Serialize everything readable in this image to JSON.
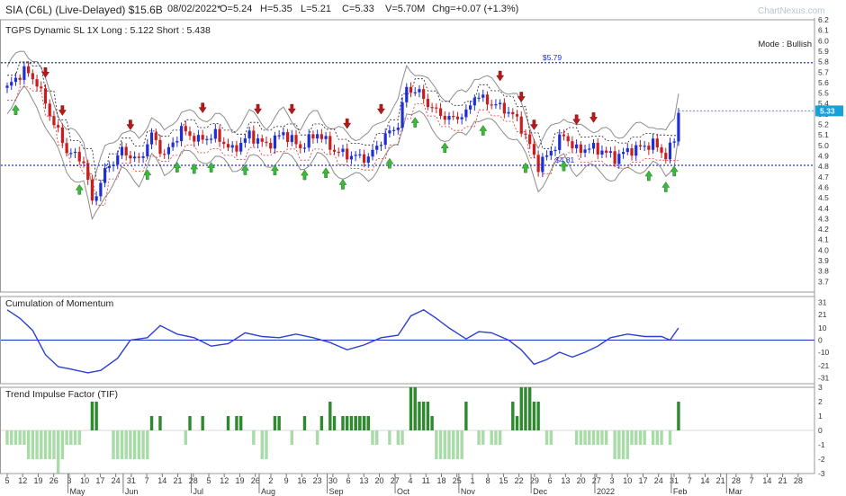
{
  "header": {
    "title": "SIA (C6L) (Live-Delayed) $15.6B",
    "date": "08/02/2022*",
    "open": "O=5.24",
    "high": "H=5.35",
    "low": "L=5.21",
    "close": "C=5.33",
    "volume": "V=5.70M",
    "change": "Chg=+0.07 (+1.3%)",
    "watermark": "ChartNexus.com"
  },
  "colors": {
    "bullish": "#1f2fd6",
    "bearish": "#c81e1e",
    "up_arrow": "#3cb83c",
    "down_arrow": "#b51a1a",
    "level_line": "#1f2fd6",
    "momentum_line": "#2a40d0",
    "tif_strong": "#2f8a2f",
    "tif_weak": "#a9dba9"
  },
  "panels": {
    "main_title": "TGPS Dynamic SL 1X Long : 5.122 Short : 5.438",
    "mode": "Mode : Bullish",
    "momentum_title": "Cumulation of Momentum",
    "tif_title": "Trend Impulse Factor (TIF)"
  },
  "chart_data": [
    {
      "type": "candlestick",
      "title": "TGPS Dynamic SL 1X Long : 5.122 Short : 5.438",
      "ylim": [
        3.6,
        6.2
      ],
      "y_ticks": [
        "6.2",
        "6.1",
        "6.0",
        "5.9",
        "5.8",
        "5.7",
        "5.6",
        "5.5",
        "5.4",
        "5.3",
        "5.2",
        "5.1",
        "5.0",
        "4.9",
        "4.8",
        "4.7",
        "4.6",
        "4.5",
        "4.4",
        "4.3",
        "4.2",
        "4.1",
        "4.0",
        "3.9",
        "3.8",
        "3.7"
      ],
      "levels": [
        {
          "label": "$5.79",
          "value": 5.79
        },
        {
          "label": "$4.81",
          "value": 4.81
        }
      ],
      "last_price": {
        "label": "5.33",
        "value": 5.33
      },
      "close_path": [
        {
          "t": 0,
          "c": 5.55
        },
        {
          "t": 4,
          "c": 5.72
        },
        {
          "t": 7,
          "c": 5.6
        },
        {
          "t": 10,
          "c": 5.3
        },
        {
          "t": 14,
          "c": 4.95
        },
        {
          "t": 18,
          "c": 4.85
        },
        {
          "t": 20,
          "c": 4.45
        },
        {
          "t": 23,
          "c": 4.75
        },
        {
          "t": 27,
          "c": 4.95
        },
        {
          "t": 31,
          "c": 4.85
        },
        {
          "t": 34,
          "c": 5.1
        },
        {
          "t": 37,
          "c": 4.9
        },
        {
          "t": 41,
          "c": 5.15
        },
        {
          "t": 45,
          "c": 5.05
        },
        {
          "t": 49,
          "c": 5.1
        },
        {
          "t": 53,
          "c": 4.95
        },
        {
          "t": 57,
          "c": 5.1
        },
        {
          "t": 61,
          "c": 5.0
        },
        {
          "t": 65,
          "c": 5.12
        },
        {
          "t": 69,
          "c": 4.98
        },
        {
          "t": 73,
          "c": 5.12
        },
        {
          "t": 77,
          "c": 4.95
        },
        {
          "t": 81,
          "c": 4.9
        },
        {
          "t": 85,
          "c": 4.88
        },
        {
          "t": 88,
          "c": 5.05
        },
        {
          "t": 92,
          "c": 5.2
        },
        {
          "t": 94,
          "c": 5.55
        },
        {
          "t": 97,
          "c": 5.5
        },
        {
          "t": 100,
          "c": 5.35
        },
        {
          "t": 104,
          "c": 5.25
        },
        {
          "t": 108,
          "c": 5.3
        },
        {
          "t": 110,
          "c": 5.48
        },
        {
          "t": 113,
          "c": 5.42
        },
        {
          "t": 117,
          "c": 5.35
        },
        {
          "t": 120,
          "c": 5.25
        },
        {
          "t": 123,
          "c": 5.0
        },
        {
          "t": 125,
          "c": 4.8
        },
        {
          "t": 128,
          "c": 4.95
        },
        {
          "t": 131,
          "c": 5.1
        },
        {
          "t": 134,
          "c": 4.95
        },
        {
          "t": 137,
          "c": 4.98
        },
        {
          "t": 140,
          "c": 4.95
        },
        {
          "t": 143,
          "c": 4.88
        },
        {
          "t": 146,
          "c": 4.95
        },
        {
          "t": 149,
          "c": 4.98
        },
        {
          "t": 152,
          "c": 5.02
        },
        {
          "t": 155,
          "c": 4.9
        },
        {
          "t": 157,
          "c": 5.05
        },
        {
          "t": 158,
          "c": 5.33
        }
      ],
      "buy_arrow_at": [
        2,
        17,
        33,
        40,
        44,
        48,
        56,
        63,
        70,
        75,
        79,
        90,
        96,
        103,
        112,
        122,
        131,
        151,
        155,
        157
      ],
      "sell_arrow_at": [
        9,
        13,
        29,
        46,
        59,
        67,
        80,
        88,
        116,
        121,
        124,
        134,
        138
      ]
    },
    {
      "type": "line",
      "title": "Cumulation of Momentum",
      "ylim": [
        -36,
        36
      ],
      "y_ticks": [
        "31",
        "21",
        "10",
        "0",
        "-10",
        "-21",
        "-31"
      ],
      "points": [
        {
          "t": 0,
          "v": 25
        },
        {
          "t": 3,
          "v": 18
        },
        {
          "t": 6,
          "v": 8
        },
        {
          "t": 9,
          "v": -12
        },
        {
          "t": 12,
          "v": -22
        },
        {
          "t": 15,
          "v": -24
        },
        {
          "t": 19,
          "v": -27
        },
        {
          "t": 22,
          "v": -25
        },
        {
          "t": 26,
          "v": -15
        },
        {
          "t": 29,
          "v": 0
        },
        {
          "t": 33,
          "v": 2
        },
        {
          "t": 36,
          "v": 12
        },
        {
          "t": 40,
          "v": 5
        },
        {
          "t": 44,
          "v": 2
        },
        {
          "t": 48,
          "v": -5
        },
        {
          "t": 52,
          "v": -3
        },
        {
          "t": 56,
          "v": 6
        },
        {
          "t": 60,
          "v": 3
        },
        {
          "t": 64,
          "v": 2
        },
        {
          "t": 68,
          "v": 5
        },
        {
          "t": 72,
          "v": 2
        },
        {
          "t": 76,
          "v": -2
        },
        {
          "t": 80,
          "v": -8
        },
        {
          "t": 84,
          "v": -4
        },
        {
          "t": 88,
          "v": 2
        },
        {
          "t": 92,
          "v": 4
        },
        {
          "t": 95,
          "v": 20
        },
        {
          "t": 98,
          "v": 25
        },
        {
          "t": 101,
          "v": 18
        },
        {
          "t": 104,
          "v": 10
        },
        {
          "t": 108,
          "v": 1
        },
        {
          "t": 111,
          "v": 7
        },
        {
          "t": 114,
          "v": 6
        },
        {
          "t": 118,
          "v": 0
        },
        {
          "t": 121,
          "v": -8
        },
        {
          "t": 124,
          "v": -20
        },
        {
          "t": 127,
          "v": -16
        },
        {
          "t": 130,
          "v": -10
        },
        {
          "t": 133,
          "v": -14
        },
        {
          "t": 136,
          "v": -10
        },
        {
          "t": 139,
          "v": -5
        },
        {
          "t": 142,
          "v": 2
        },
        {
          "t": 146,
          "v": 5
        },
        {
          "t": 150,
          "v": 3
        },
        {
          "t": 154,
          "v": 3
        },
        {
          "t": 156,
          "v": 0
        },
        {
          "t": 158,
          "v": 10
        }
      ]
    },
    {
      "type": "bar",
      "title": "Trend Impulse Factor (TIF)",
      "ylim": [
        -3,
        3
      ],
      "y_ticks": [
        "3",
        "2",
        "1",
        "0",
        "-1",
        "-2",
        "-3"
      ],
      "segments": [
        {
          "from": 0,
          "to": 4,
          "v": -1
        },
        {
          "from": 5,
          "to": 8,
          "v": -2
        },
        {
          "from": 9,
          "to": 13,
          "v": -2
        },
        {
          "from": 12,
          "to": 12,
          "v": -3
        },
        {
          "from": 14,
          "to": 17,
          "v": -1
        },
        {
          "from": 20,
          "to": 21,
          "v": 2
        },
        {
          "from": 25,
          "to": 26,
          "v": -2
        },
        {
          "from": 27,
          "to": 33,
          "v": -2
        },
        {
          "from": 34,
          "to": 34,
          "v": 1
        },
        {
          "from": 36,
          "to": 36,
          "v": 1
        },
        {
          "from": 42,
          "to": 42,
          "v": -1
        },
        {
          "from": 43,
          "to": 43,
          "v": 1
        },
        {
          "from": 46,
          "to": 46,
          "v": 1
        },
        {
          "from": 52,
          "to": 52,
          "v": 1
        },
        {
          "from": 54,
          "to": 55,
          "v": 1
        },
        {
          "from": 58,
          "to": 58,
          "v": -1
        },
        {
          "from": 60,
          "to": 61,
          "v": -2
        },
        {
          "from": 63,
          "to": 64,
          "v": 1
        },
        {
          "from": 67,
          "to": 67,
          "v": -1
        },
        {
          "from": 70,
          "to": 70,
          "v": 1
        },
        {
          "from": 73,
          "to": 73,
          "v": -1
        },
        {
          "from": 74,
          "to": 74,
          "v": 1
        },
        {
          "from": 76,
          "to": 76,
          "v": 2
        },
        {
          "from": 77,
          "to": 77,
          "v": 1
        },
        {
          "from": 79,
          "to": 85,
          "v": 1
        },
        {
          "from": 82,
          "to": 85,
          "v": 1
        },
        {
          "from": 86,
          "to": 87,
          "v": -1
        },
        {
          "from": 90,
          "to": 90,
          "v": -1
        },
        {
          "from": 92,
          "to": 93,
          "v": -1
        },
        {
          "from": 95,
          "to": 96,
          "v": 3
        },
        {
          "from": 97,
          "to": 99,
          "v": 2
        },
        {
          "from": 100,
          "to": 100,
          "v": 1
        },
        {
          "from": 101,
          "to": 107,
          "v": -2
        },
        {
          "from": 108,
          "to": 108,
          "v": 2
        },
        {
          "from": 111,
          "to": 112,
          "v": -1
        },
        {
          "from": 114,
          "to": 116,
          "v": -1
        },
        {
          "from": 119,
          "to": 119,
          "v": 2
        },
        {
          "from": 120,
          "to": 120,
          "v": 1
        },
        {
          "from": 121,
          "to": 123,
          "v": 3
        },
        {
          "from": 124,
          "to": 125,
          "v": 2
        },
        {
          "from": 127,
          "to": 128,
          "v": -1
        },
        {
          "from": 134,
          "to": 135,
          "v": -1
        },
        {
          "from": 136,
          "to": 141,
          "v": -1
        },
        {
          "from": 143,
          "to": 146,
          "v": -2
        },
        {
          "from": 147,
          "to": 150,
          "v": -1
        },
        {
          "from": 152,
          "to": 154,
          "v": -1
        },
        {
          "from": 156,
          "to": 156,
          "v": -1
        },
        {
          "from": 158,
          "to": 158,
          "v": 2
        }
      ]
    }
  ],
  "x_axis": {
    "day_labels": [
      "5",
      "12",
      "19",
      "26",
      "3",
      "10",
      "17",
      "24",
      "31",
      "7",
      "14",
      "21",
      "28",
      "5",
      "12",
      "19",
      "26",
      "2",
      "9",
      "16",
      "23",
      "30",
      "6",
      "13",
      "20",
      "27",
      "4",
      "11",
      "18",
      "25",
      "1",
      "8",
      "15",
      "22",
      "29",
      "6",
      "13",
      "20",
      "27",
      "3",
      "10",
      "17",
      "24",
      "31",
      "7",
      "14",
      "21",
      "28",
      "7",
      "14",
      "21",
      "28"
    ],
    "month_labels": [
      {
        "label": "May",
        "at": 16
      },
      {
        "label": "Jun",
        "at": 29
      },
      {
        "label": "Jul",
        "at": 45
      },
      {
        "label": "Aug",
        "at": 61
      },
      {
        "label": "Sep",
        "at": 77
      },
      {
        "label": "Oct",
        "at": 93
      },
      {
        "label": "Nov",
        "at": 108
      },
      {
        "label": "Dec",
        "at": 125
      },
      {
        "label": "2022",
        "at": 140
      },
      {
        "label": "Feb",
        "at": 158
      },
      {
        "label": "Mar",
        "at": 171
      }
    ]
  }
}
